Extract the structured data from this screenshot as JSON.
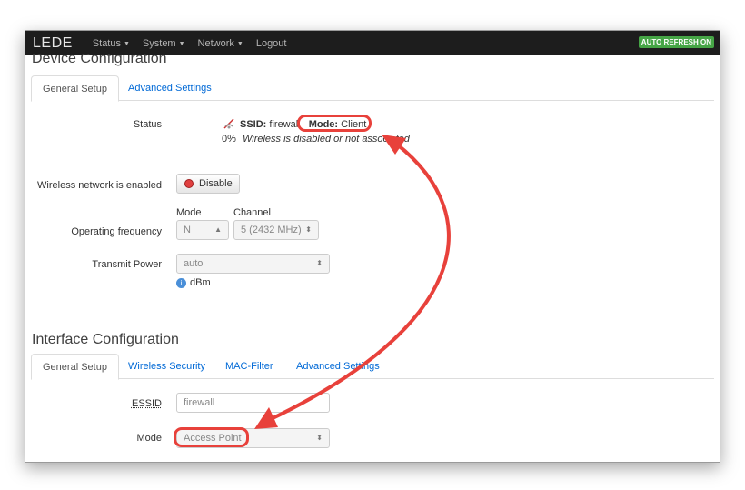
{
  "topbar": {
    "brand": "LEDE",
    "menu": [
      {
        "label": "Status",
        "has_caret": true
      },
      {
        "label": "System",
        "has_caret": true
      },
      {
        "label": "Network",
        "has_caret": true
      },
      {
        "label": "Logout",
        "has_caret": false
      }
    ],
    "auto_refresh": "AUTO REFRESH ON"
  },
  "device": {
    "title": "Device Configuration",
    "tabs": [
      "General Setup",
      "Advanced Settings"
    ],
    "status": {
      "label": "Status",
      "ssid_label": "SSID:",
      "ssid_value": "firewall",
      "mode_label": "Mode:",
      "mode_value": "Client",
      "percent": "0%",
      "message": "Wireless is disabled or not associated"
    },
    "wireless_enabled": {
      "label": "Wireless network is enabled",
      "button": "Disable"
    },
    "frequency": {
      "label": "Operating frequency",
      "mode_heading": "Mode",
      "channel_heading": "Channel",
      "mode_value": "N",
      "channel_value": "5 (2432 MHz)"
    },
    "transmit_power": {
      "label": "Transmit Power",
      "value": "auto",
      "unit": "dBm"
    }
  },
  "interface": {
    "title": "Interface Configuration",
    "tabs": [
      "General Setup",
      "Wireless Security",
      "MAC-Filter",
      "Advanced Settings"
    ],
    "essid": {
      "label": "ESSID",
      "value": "firewall"
    },
    "mode": {
      "label": "Mode",
      "value": "Access Point"
    }
  },
  "colors": {
    "annotation": "#e8413b",
    "link": "#0069d6",
    "badge": "#46a546"
  }
}
